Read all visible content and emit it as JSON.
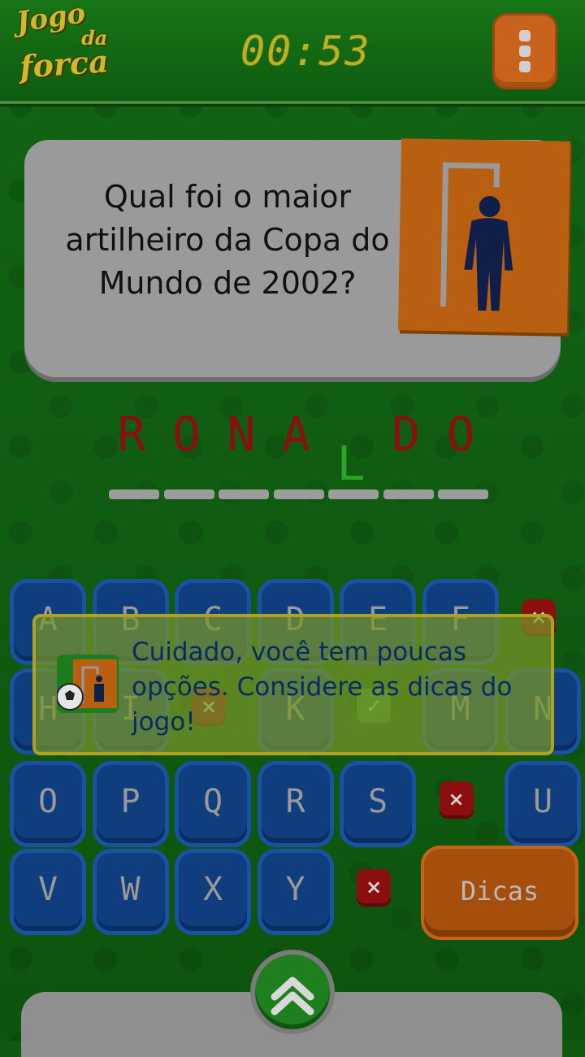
{
  "header": {
    "logo_line1": "Jogo",
    "logo_line2": "da",
    "logo_line3": "forca",
    "timer": "00:53",
    "menu_icon": "vertical-dots-icon"
  },
  "question": {
    "text": "Qual foi o maior artilheiro da Copa do Mundo de 2002?"
  },
  "word": {
    "letters": [
      {
        "char": "R",
        "state": "revealed"
      },
      {
        "char": "O",
        "state": "revealed"
      },
      {
        "char": "N",
        "state": "revealed"
      },
      {
        "char": "A",
        "state": "revealed"
      },
      {
        "char": "L",
        "state": "correct"
      },
      {
        "char": "D",
        "state": "revealed"
      },
      {
        "char": "O",
        "state": "revealed"
      }
    ]
  },
  "keyboard": {
    "rows": [
      [
        {
          "label": "A"
        },
        {
          "label": "B"
        },
        {
          "label": "C"
        },
        {
          "label": "D"
        },
        {
          "label": "E"
        },
        {
          "label": "F"
        },
        {
          "label": "",
          "status": "wrong",
          "mark": "×"
        }
      ],
      [
        {
          "label": "H"
        },
        {
          "label": "I"
        },
        {
          "label": "",
          "status": "wrong",
          "mark": "×"
        },
        {
          "label": "K"
        },
        {
          "label": "",
          "status": "right",
          "mark": "✓"
        },
        {
          "label": "M"
        },
        {
          "label": "N"
        }
      ],
      [
        {
          "label": "O"
        },
        {
          "label": "P"
        },
        {
          "label": "Q"
        },
        {
          "label": "R"
        },
        {
          "label": "S"
        },
        {
          "label": "",
          "status": "wrong",
          "mark": "×"
        },
        {
          "label": "U"
        }
      ],
      [
        {
          "label": "V"
        },
        {
          "label": "W"
        },
        {
          "label": "X"
        },
        {
          "label": "Y"
        },
        {
          "label": "",
          "status": "wrong",
          "mark": "×"
        }
      ]
    ],
    "hint_label": "Dicas"
  },
  "toast": {
    "text": "Cuidado, você tem poucas opções. Considere as dicas do jogo!"
  },
  "colors": {
    "background": "#126414",
    "wrong": "#8c0f0f",
    "correct": "#2aa42a",
    "accent": "#c9621a"
  }
}
